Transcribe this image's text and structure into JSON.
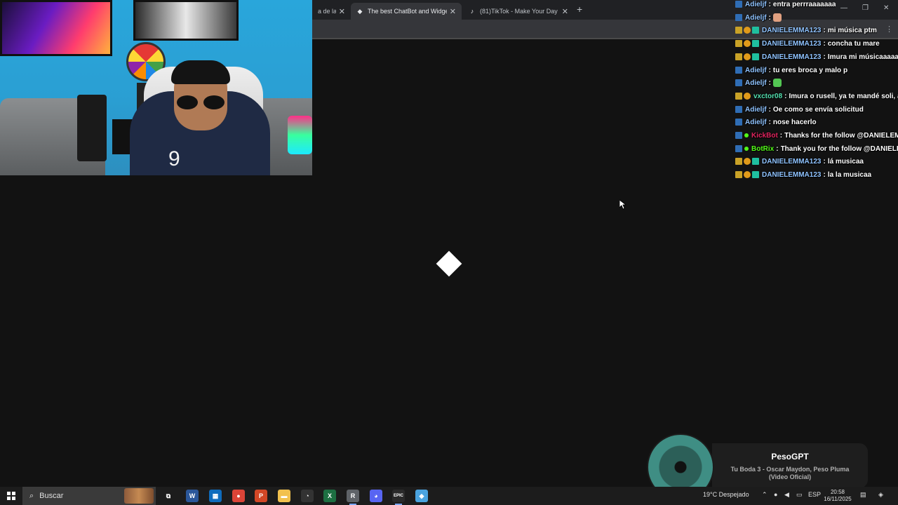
{
  "browser": {
    "tabs": [
      {
        "label": "a de la S",
        "active": false
      },
      {
        "label": "The best ChatBot and Widgets",
        "active": true
      },
      {
        "label": "(81)TikTok - Make Your Day",
        "active": false
      }
    ],
    "new_tab_label": "+",
    "close_glyph": "✕",
    "window_controls": {
      "minimize": "—",
      "restore": "❐",
      "close": "✕"
    }
  },
  "webcam": {
    "shirt_number": "9"
  },
  "chat": {
    "separator": ":",
    "messages": [
      {
        "user": "Adieljf",
        "user_color": "#8fc3ff",
        "badges": [
          "kick"
        ],
        "text": "entra perrraaaaaaa",
        "emote": null
      },
      {
        "user": "Adieljf",
        "user_color": "#8fc3ff",
        "badges": [
          "kick"
        ],
        "text": "",
        "emote": "thumb"
      },
      {
        "user": "DANIELEMMA123",
        "user_color": "#8fc3ff",
        "badges": [
          "sub",
          "og",
          "gem"
        ],
        "text": "mi música ptm",
        "emote": null
      },
      {
        "user": "DANIELEMMA123",
        "user_color": "#8fc3ff",
        "badges": [
          "sub",
          "og",
          "gem"
        ],
        "text": "concha tu mare",
        "emote": null
      },
      {
        "user": "DANIELEMMA123",
        "user_color": "#8fc3ff",
        "badges": [
          "sub",
          "og",
          "gem"
        ],
        "text": "Imura mi músicaaaaaa",
        "emote": null
      },
      {
        "user": "Adieljf",
        "user_color": "#8fc3ff",
        "badges": [
          "kick"
        ],
        "text": "tu eres broca y malo p",
        "emote": null
      },
      {
        "user": "Adieljf",
        "user_color": "#8fc3ff",
        "badges": [
          "kick"
        ],
        "text": "",
        "emote": "green"
      },
      {
        "user": "vxctor08",
        "user_color": "#53e0b0",
        "badges": [
          "sub",
          "og"
        ],
        "text": "Imura o rusell, ya te mandé soli, ace",
        "emote": null
      },
      {
        "user": "Adieljf",
        "user_color": "#8fc3ff",
        "badges": [
          "kick"
        ],
        "text": "Oe como se envía solicitud",
        "emote": null
      },
      {
        "user": "Adieljf",
        "user_color": "#8fc3ff",
        "badges": [
          "kick"
        ],
        "text": "nose hacerlo",
        "emote": null
      },
      {
        "user": "KickBot",
        "user_color": "#e0245e",
        "badges": [
          "kick",
          "bot"
        ],
        "text": "Thanks for the follow @DANIELEMM",
        "emote": null
      },
      {
        "user": "BotRix",
        "user_color": "#53fc18",
        "badges": [
          "kick",
          "bot"
        ],
        "text": "Thank you for the follow @DANIELEM",
        "emote": null
      },
      {
        "user": "DANIELEMMA123",
        "user_color": "#8fc3ff",
        "badges": [
          "sub",
          "og",
          "gem"
        ],
        "text": "lá musicaa",
        "emote": null
      },
      {
        "user": "DANIELEMMA123",
        "user_color": "#8fc3ff",
        "badges": [
          "sub",
          "og",
          "gem"
        ],
        "text": "la la musicaa",
        "emote": null
      }
    ]
  },
  "now_playing": {
    "title": "PesoGPT",
    "song": "Tu Boda 3 - Oscar Maydon, Peso Pluma (Video Oficial)"
  },
  "taskbar": {
    "search_placeholder": "Buscar",
    "apps": [
      {
        "name": "task-view",
        "glyph": "⧉",
        "color": "transparent"
      },
      {
        "name": "word",
        "glyph": "W",
        "color": "#2b579a"
      },
      {
        "name": "store",
        "glyph": "▦",
        "color": "#0f6cbd"
      },
      {
        "name": "chrome",
        "glyph": "●",
        "color": "#db4437"
      },
      {
        "name": "powerpoint",
        "glyph": "P",
        "color": "#d24726"
      },
      {
        "name": "file-explorer",
        "glyph": "▬",
        "color": "#f2c14e"
      },
      {
        "name": "speedometer",
        "glyph": "◔",
        "color": "#333333"
      },
      {
        "name": "excel",
        "glyph": "X",
        "color": "#1d6f42"
      },
      {
        "name": "chrome-profile",
        "glyph": "R",
        "color": "#5f6368"
      },
      {
        "name": "discord-like",
        "glyph": "◕",
        "color": "#5865f2"
      },
      {
        "name": "epic-games",
        "glyph": "EPIC",
        "color": "#2a2a2a"
      },
      {
        "name": "notes",
        "glyph": "◆",
        "color": "#4aa3df"
      }
    ],
    "weather": "19°C  Despejado",
    "language": "ESP",
    "time": "20:58",
    "date": "16/11/2025"
  }
}
